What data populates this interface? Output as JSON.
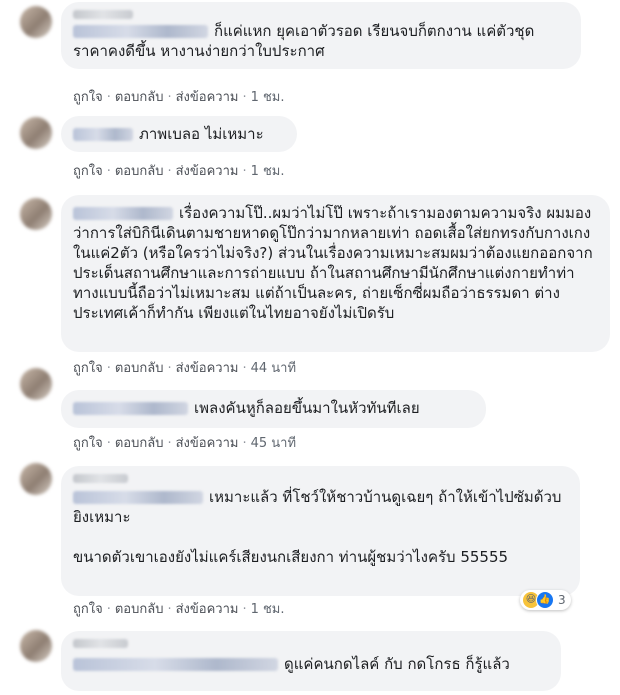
{
  "actions": {
    "like": "ถูกใจ",
    "reply": "ตอบกลับ",
    "message": "ส่งข้อความ",
    "dot": "·"
  },
  "comments": [
    {
      "text": "ก็แค่แหก ยุคเอาตัวรอด เรียนจบก็ตกงาน แค่ตัวชุด ราคาคงดีขึ้น หางานง่ายกว่าใบประกาศ",
      "time": "1 ชม."
    },
    {
      "text": "ภาพเบลอ ไม่เหมาะ",
      "time": "1 ชม."
    },
    {
      "text": "เรื่องความโป๊..ผมว่าไม่โป๊ เพราะถ้าเรามองตามความจริง ผมมองว่าการใส่บิกินีเดินตามชายหาดดูโป๊กว่ามากหลายเท่า ถอดเสื้อใส่ยกทรงกับกางเกงในแค่2ตัว (หรือใครว่าไม่จริง?) ส่วนในเรื่องความเหมาะสมผมว่าต้องแยกออกจากประเด็นสถานศึกษาและการถ่ายแบบ ถ้าในสถานศึกษามีนักศึกษาแต่งกายทำท่าทางแบบนี้ถือว่าไม่เหมาะสม แต่ถ้าเป็นละคร, ถ่ายเซ็กซี่ผมถือว่าธรรมดา ต่างประเทศเค้าก็ทำกัน เพียงแต่ในไทยอาจยังไม่เปิดรับ",
      "time": "44 นาที"
    },
    {
      "text": "เพลงคันหูก็ลอยขึ้นมาในหัวทันทีเลย",
      "time": "45 นาที"
    },
    {
      "text": "เหมาะแล้ว ที่โชว์ให้ชาวบ้านดูเฉยๆ ถ้าให้เข้าไปซัมด้วบยิงเหมาะ",
      "text2": "ขนาดตัวเขาเองยังไม่แคร์เสียงนกเสียงกา ท่านผู้ชมว่าไงครับ 55555",
      "time": "1 ชม.",
      "reaction_count": "3"
    },
    {
      "text": "ดูแค่คนกดไลค์ กับ กดโกรธ ก็รู้แล้ว"
    }
  ]
}
